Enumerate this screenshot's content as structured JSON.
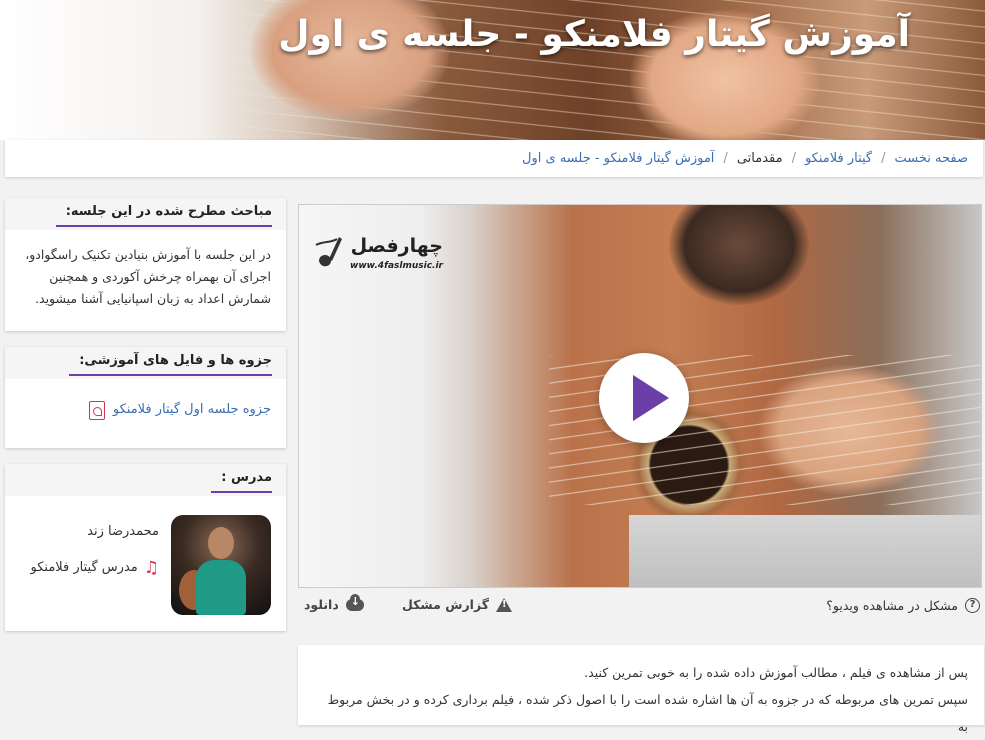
{
  "hero": {
    "title": "آموزش گیتار فلامنکو - جلسه ی اول"
  },
  "breadcrumb": {
    "items": [
      {
        "label": "صفحه نخست",
        "link": true
      },
      {
        "label": "گیتار فلامنکو",
        "link": true
      },
      {
        "label": "مقدماتی",
        "link": false
      },
      {
        "label": "آموزش گیتار فلامنکو - جلسه ی اول",
        "link": true
      }
    ]
  },
  "topics": {
    "title": "مباحث مطرح شده در این جلسه:",
    "text": "در این جلسه با آموزش بنیادین تکنیک راسگوادو، اجرای آن بهمراه چرخش آکوردی و همچنین شمارش اعداد به زبان اسپانیایی آشنا میشوید."
  },
  "files": {
    "title": "جزوه ها و فایل های آموزشی:",
    "items": [
      {
        "label": "جزوه جلسه اول گیتار فلامنکو",
        "icon": "pdf-icon"
      }
    ]
  },
  "teacher": {
    "title": "مدرس :",
    "name": "محمدرضا زند",
    "role": "مدرس گیتار فلامنکو",
    "role_icon": "music-note-icon"
  },
  "video": {
    "logo_title": "چهارفصل",
    "logo_url": "www.4faslmusic.ir",
    "help_text": "مشکل در مشاهده ویدیو؟",
    "report_label": "گزارش مشکل",
    "download_label": "دانلود"
  },
  "description": {
    "line1": "پس از مشاهده ی فیلم ، مطالب آموزش داده شده را به خوبی تمرین کنید.",
    "line2": "سپس تمرین های مربوطه که در جزوه به آن ها اشاره شده است  را با اصول ذکر شده ، فیلم برداری کرده و در بخش مربوط به"
  },
  "colors": {
    "accent": "#6a3fa8",
    "link": "#3a6fb0",
    "pdf": "#d9334d"
  }
}
